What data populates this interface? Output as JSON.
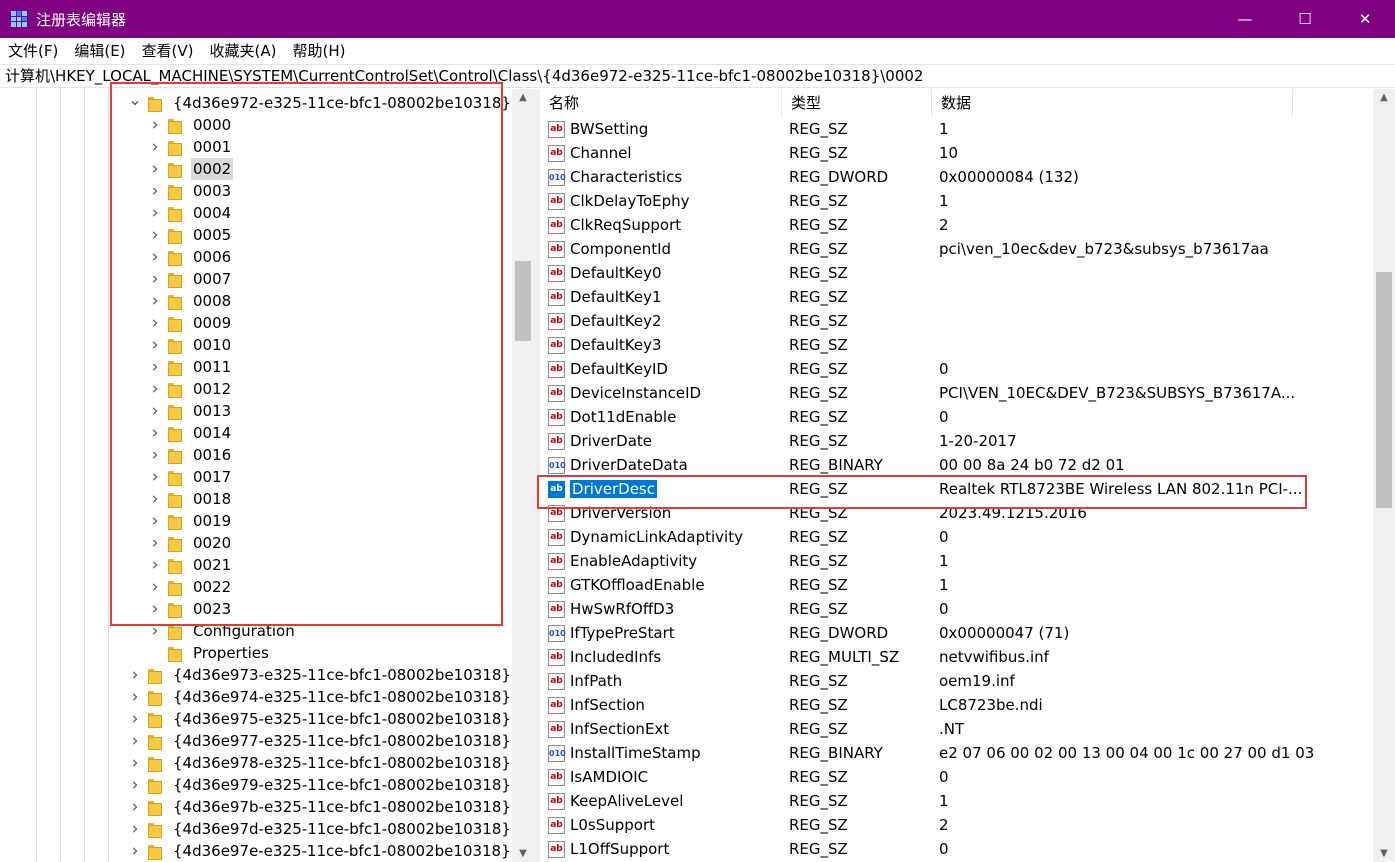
{
  "window": {
    "title": "注册表编辑器",
    "controls": [
      "—",
      "☐",
      "✕"
    ]
  },
  "menu": [
    "文件(F)",
    "编辑(E)",
    "查看(V)",
    "收藏夹(A)",
    "帮助(H)"
  ],
  "address": "计算机\\HKEY_LOCAL_MACHINE\\SYSTEM\\CurrentControlSet\\Control\\Class\\{4d36e972-e325-11ce-bfc1-08002be10318}\\0002",
  "tree": {
    "parent": "{4d36e972-e325-11ce-bfc1-08002be10318}",
    "children": [
      "0000",
      "0001",
      "0002",
      "0003",
      "0004",
      "0005",
      "0006",
      "0007",
      "0008",
      "0009",
      "0010",
      "0011",
      "0012",
      "0013",
      "0014",
      "0016",
      "0017",
      "0018",
      "0019",
      "0020",
      "0021",
      "0022",
      "0023"
    ],
    "selected": "0002",
    "extra_children": [
      "Configuration",
      "Properties"
    ],
    "siblings": [
      "{4d36e973-e325-11ce-bfc1-08002be10318}",
      "{4d36e974-e325-11ce-bfc1-08002be10318}",
      "{4d36e975-e325-11ce-bfc1-08002be10318}",
      "{4d36e977-e325-11ce-bfc1-08002be10318}",
      "{4d36e978-e325-11ce-bfc1-08002be10318}",
      "{4d36e979-e325-11ce-bfc1-08002be10318}",
      "{4d36e97b-e325-11ce-bfc1-08002be10318}",
      "{4d36e97d-e325-11ce-bfc1-08002be10318}",
      "{4d36e97e-e325-11ce-bfc1-08002be10318}"
    ]
  },
  "columns": [
    "名称",
    "类型",
    "数据"
  ],
  "values": [
    {
      "name": "BWSetting",
      "type": "REG_SZ",
      "data": "1",
      "icon": "sz"
    },
    {
      "name": "Channel",
      "type": "REG_SZ",
      "data": "10",
      "icon": "sz"
    },
    {
      "name": "Characteristics",
      "type": "REG_DWORD",
      "data": "0x00000084 (132)",
      "icon": "bin"
    },
    {
      "name": "ClkDelayToEphy",
      "type": "REG_SZ",
      "data": "1",
      "icon": "sz"
    },
    {
      "name": "ClkReqSupport",
      "type": "REG_SZ",
      "data": "2",
      "icon": "sz"
    },
    {
      "name": "ComponentId",
      "type": "REG_SZ",
      "data": "pci\\ven_10ec&dev_b723&subsys_b73617aa",
      "icon": "sz"
    },
    {
      "name": "DefaultKey0",
      "type": "REG_SZ",
      "data": "",
      "icon": "sz"
    },
    {
      "name": "DefaultKey1",
      "type": "REG_SZ",
      "data": "",
      "icon": "sz"
    },
    {
      "name": "DefaultKey2",
      "type": "REG_SZ",
      "data": "",
      "icon": "sz"
    },
    {
      "name": "DefaultKey3",
      "type": "REG_SZ",
      "data": "",
      "icon": "sz"
    },
    {
      "name": "DefaultKeyID",
      "type": "REG_SZ",
      "data": "0",
      "icon": "sz"
    },
    {
      "name": "DeviceInstanceID",
      "type": "REG_SZ",
      "data": "PCI\\VEN_10EC&DEV_B723&SUBSYS_B73617A...",
      "icon": "sz"
    },
    {
      "name": "Dot11dEnable",
      "type": "REG_SZ",
      "data": "0",
      "icon": "sz"
    },
    {
      "name": "DriverDate",
      "type": "REG_SZ",
      "data": "1-20-2017",
      "icon": "sz"
    },
    {
      "name": "DriverDateData",
      "type": "REG_BINARY",
      "data": "00 00 8a 24 b0 72 d2 01",
      "icon": "bin"
    },
    {
      "name": "DriverDesc",
      "type": "REG_SZ",
      "data": "Realtek RTL8723BE Wireless LAN 802.11n PCI-...",
      "icon": "sz",
      "selected": true
    },
    {
      "name": "DriverVersion",
      "type": "REG_SZ",
      "data": "2023.49.1215.2016",
      "icon": "sz"
    },
    {
      "name": "DynamicLinkAdaptivity",
      "type": "REG_SZ",
      "data": "0",
      "icon": "sz"
    },
    {
      "name": "EnableAdaptivity",
      "type": "REG_SZ",
      "data": "1",
      "icon": "sz"
    },
    {
      "name": "GTKOffloadEnable",
      "type": "REG_SZ",
      "data": "1",
      "icon": "sz"
    },
    {
      "name": "HwSwRfOffD3",
      "type": "REG_SZ",
      "data": "0",
      "icon": "sz"
    },
    {
      "name": "IfTypePreStart",
      "type": "REG_DWORD",
      "data": "0x00000047 (71)",
      "icon": "bin"
    },
    {
      "name": "IncludedInfs",
      "type": "REG_MULTI_SZ",
      "data": "netvwifibus.inf",
      "icon": "sz"
    },
    {
      "name": "InfPath",
      "type": "REG_SZ",
      "data": "oem19.inf",
      "icon": "sz"
    },
    {
      "name": "InfSection",
      "type": "REG_SZ",
      "data": "LC8723be.ndi",
      "icon": "sz"
    },
    {
      "name": "InfSectionExt",
      "type": "REG_SZ",
      "data": ".NT",
      "icon": "sz"
    },
    {
      "name": "InstallTimeStamp",
      "type": "REG_BINARY",
      "data": "e2 07 06 00 02 00 13 00 04 00 1c 00 27 00 d1 03",
      "icon": "bin"
    },
    {
      "name": "IsAMDIOIC",
      "type": "REG_SZ",
      "data": "0",
      "icon": "sz"
    },
    {
      "name": "KeepAliveLevel",
      "type": "REG_SZ",
      "data": "1",
      "icon": "sz"
    },
    {
      "name": "L0sSupport",
      "type": "REG_SZ",
      "data": "2",
      "icon": "sz"
    },
    {
      "name": "L1OffSupport",
      "type": "REG_SZ",
      "data": "0",
      "icon": "sz"
    }
  ],
  "icons": {
    "sz": "ab",
    "bin": "011\n110"
  },
  "colors": {
    "titlebar": "#7f0081",
    "selection": "#0078d7",
    "annotation": "#e53935"
  }
}
